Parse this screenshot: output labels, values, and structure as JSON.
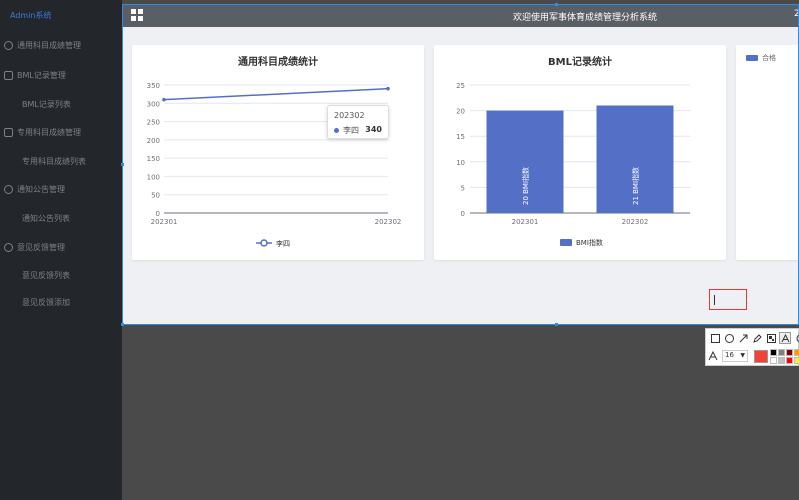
{
  "sidebar": {
    "brand": "Admin系统",
    "items": [
      {
        "label": "通用科目成绩管理",
        "icon": "chart-icon",
        "type": "group"
      },
      {
        "label": "BML记录管理",
        "icon": "document-icon",
        "type": "group"
      },
      {
        "label": "BML记录列表",
        "type": "sub"
      },
      {
        "label": "专用科目成绩管理",
        "icon": "bar-chart-icon",
        "type": "group"
      },
      {
        "label": "专用科目成绩列表",
        "type": "sub"
      },
      {
        "label": "通知公告管理",
        "icon": "bell-icon",
        "type": "group"
      },
      {
        "label": "通知公告列表",
        "type": "sub"
      },
      {
        "label": "意见反馈管理",
        "icon": "feedback-icon",
        "type": "group"
      },
      {
        "label": "意见反馈列表",
        "type": "sub"
      },
      {
        "label": "意见反馈添加",
        "type": "sub"
      }
    ]
  },
  "header": {
    "title": "欢迎使用军事体育成绩管理分析系统",
    "corner": "2"
  },
  "tooltip": {
    "category": "202302",
    "series": "李四",
    "value": "340"
  },
  "chart_data": [
    {
      "type": "line",
      "title": "通用科目成绩统计",
      "categories": [
        "202301",
        "202302"
      ],
      "series": [
        {
          "name": "李四",
          "values": [
            310,
            340
          ]
        }
      ],
      "yticks": [
        0,
        50,
        100,
        150,
        200,
        250,
        300,
        350
      ],
      "ylim": [
        0,
        350
      ],
      "legend": "bottom-center",
      "color": "#5470c6"
    },
    {
      "type": "bar",
      "title": "BML记录统计",
      "categories": [
        "202301",
        "202302"
      ],
      "series": [
        {
          "name": "BMI指数",
          "values": [
            20,
            21
          ]
        }
      ],
      "data_labels": [
        "20  BMI指数",
        "21  BMI指数"
      ],
      "yticks": [
        0,
        5,
        10,
        15,
        20,
        25
      ],
      "ylim": [
        0,
        25
      ],
      "legend": "bottom-center",
      "color": "#5470c6"
    },
    {
      "type": "bar",
      "title": "",
      "series": [
        {
          "name": "合格",
          "values": []
        }
      ],
      "legend": "top-left",
      "color": "#5470c6"
    }
  ],
  "toolbar": {
    "font_size": "16",
    "current_color": "#f44336",
    "palette": [
      "#000000",
      "#808080",
      "#800000",
      "#ff9800",
      "#ffffff",
      "#c0c0c0",
      "#ff0000",
      "#ffeb3b"
    ]
  }
}
